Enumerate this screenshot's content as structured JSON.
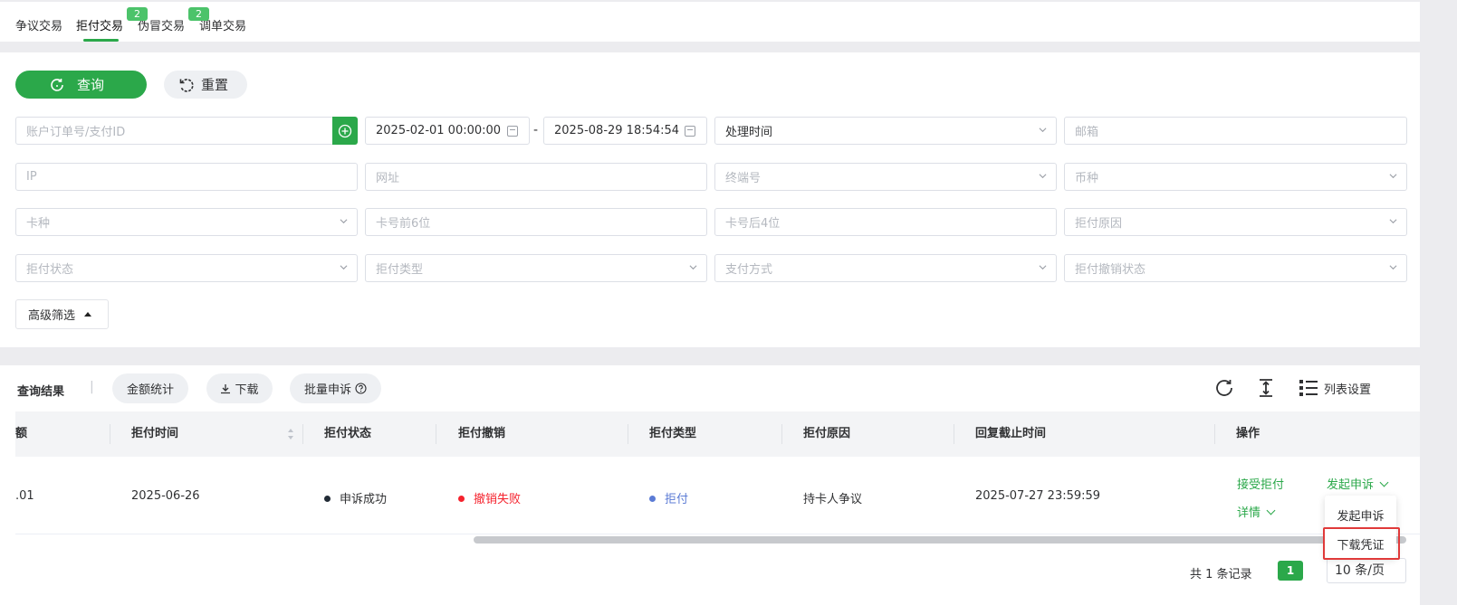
{
  "tabs": [
    {
      "label": "争议交易"
    },
    {
      "label": "拒付交易"
    },
    {
      "label": "伪冒交易",
      "badge": "2"
    },
    {
      "label": "调单交易",
      "badge": "2"
    }
  ],
  "active_tab": "拒付交易",
  "actions": {
    "query_label": "查询",
    "reset_label": "重置"
  },
  "filters": {
    "order_id_placeholder": "账户订单号/支付ID",
    "date_start": "2025-02-01 00:00:00",
    "date_sep": "-",
    "date_end": "2025-08-29 18:54:54",
    "time_type": "处理时间",
    "email_placeholder": "邮箱",
    "ip_placeholder": "IP",
    "url_placeholder": "网址",
    "terminal_placeholder": "终端号",
    "currency_placeholder": "币种",
    "card_type_placeholder": "卡种",
    "card_first6_placeholder": "卡号前6位",
    "card_last4_placeholder": "卡号后4位",
    "reason_placeholder": "拒付原因",
    "status_placeholder": "拒付状态",
    "type_placeholder": "拒付类型",
    "payment_placeholder": "支付方式",
    "revoke_status_placeholder": "拒付撤销状态",
    "advanced_label": "高级筛选"
  },
  "results": {
    "title": "查询结果",
    "separator": "|",
    "amount_stats_label": "金额统计",
    "download_label": "下载",
    "batch_appeal_label": "批量申诉",
    "list_settings_label": "列表设置",
    "columns": [
      "额",
      "拒付时间",
      "拒付状态",
      "拒付撤销",
      "拒付类型",
      "拒付原因",
      "回复截止时间",
      "操作"
    ],
    "rows": [
      {
        "amount": ".01",
        "chargeback_time": "2025-06-26",
        "status": "申诉成功",
        "revoke": "撤销失败",
        "type": "拒付",
        "reason": "持卡人争议",
        "deadline": "2025-07-27 23:59:59",
        "op_accept": "接受拒付",
        "op_appeal": "发起申诉",
        "op_detail": "详情"
      }
    ],
    "dropdown_items": [
      "发起申诉",
      "下载凭证"
    ],
    "total_text": "共 1 条记录",
    "current_page": "1",
    "page_size": "10 条/页"
  },
  "colors": {
    "accent": "#2ba84a",
    "danger": "#f5222d",
    "info": "#5b7bd5",
    "success_dot": "#222b36"
  }
}
